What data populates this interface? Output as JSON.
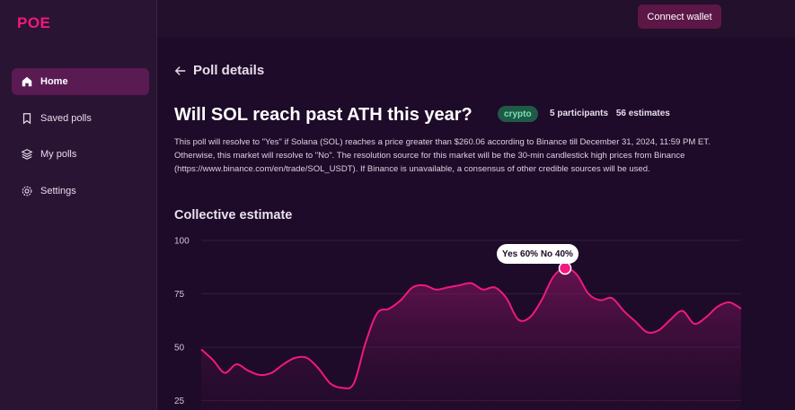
{
  "app": {
    "logo": "POE"
  },
  "sidebar": {
    "items": [
      {
        "label": "Home",
        "icon": "home-icon",
        "active": true
      },
      {
        "label": "Saved polls",
        "icon": "bookmark-icon",
        "active": false
      },
      {
        "label": "My polls",
        "icon": "layers-icon",
        "active": false
      },
      {
        "label": "Settings",
        "icon": "gear-icon",
        "active": false
      }
    ]
  },
  "header": {
    "connect_label": "Connect wallet"
  },
  "poll": {
    "back_label": "Poll details",
    "title": "Will SOL reach past ATH this year?",
    "tag": "crypto",
    "participants": "5 participants",
    "estimates": "56 estimates",
    "description": "This poll will resolve to \"Yes\" if Solana (SOL) reaches a price greater than $260.06 according to Binance till December 31, 2024, 11:59 PM ET. Otherwise, this market will resolve to \"No\". The resolution source for this market will be the 30-min candlestick high prices from Binance (https://www.binance.com/en/trade/SOL_USDT). If Binance is unavailable, a consensus of other credible sources will be used."
  },
  "chart_section": {
    "title": "Collective estimate",
    "tooltip": "Yes 60% No 40%"
  },
  "colors": {
    "accent": "#f0197d",
    "tag_bg": "#1f5a47",
    "tag_text": "#7ae0b5"
  },
  "chart_data": {
    "type": "area",
    "ylim": [
      0,
      100
    ],
    "yticks": [
      "100",
      "75",
      "50",
      "25"
    ],
    "highlight_index": 31,
    "values": [
      49,
      44,
      38,
      42,
      39,
      37,
      38,
      42,
      45,
      45,
      40,
      33,
      31,
      33,
      52,
      66,
      68,
      72,
      78,
      79,
      77,
      78,
      79,
      80,
      77,
      78,
      73,
      63,
      64,
      72,
      83,
      87,
      84,
      75,
      72,
      73,
      67,
      62,
      57,
      58,
      63,
      67,
      61,
      64,
      69,
      71,
      68
    ]
  }
}
